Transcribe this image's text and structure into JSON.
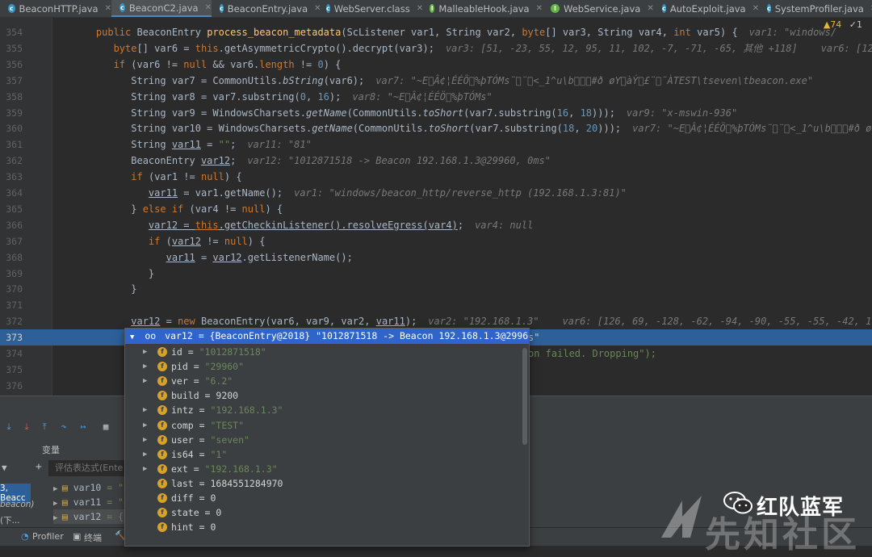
{
  "tabs": [
    {
      "label": "BeaconHTTP.java",
      "icon": "class-icon",
      "color": "#3592c4",
      "active": false
    },
    {
      "label": "BeaconC2.java",
      "icon": "class-icon",
      "color": "#3592c4",
      "active": true
    },
    {
      "label": "BeaconEntry.java",
      "icon": "class-icon",
      "color": "#3592c4",
      "active": false
    },
    {
      "label": "WebServer.class",
      "icon": "class-icon",
      "color": "#3592c4",
      "active": false
    },
    {
      "label": "MalleableHook.java",
      "icon": "interface-icon",
      "color": "#62b543",
      "active": false
    },
    {
      "label": "WebService.java",
      "icon": "interface-icon",
      "color": "#62b543",
      "active": false
    },
    {
      "label": "AutoExploit.java",
      "icon": "class-icon",
      "color": "#3592c4",
      "active": false
    },
    {
      "label": "SystemProfiler.java",
      "icon": "class-icon",
      "color": "#3592c4",
      "active": false
    }
  ],
  "inspection": {
    "warnings": "▲74",
    "weak": "✓1"
  },
  "lines": [
    {
      "n": "354",
      "segs": [
        [
          "    ",
          ""
        ],
        [
          "public ",
          "kw"
        ],
        [
          "BeaconEntry ",
          ""
        ],
        [
          "process_beacon_metadata",
          "fn"
        ],
        [
          "(ScListener var1, String var2, ",
          ""
        ],
        [
          "byte",
          "kw"
        ],
        [
          "[] var3, String var4, ",
          ""
        ],
        [
          "int ",
          "kw"
        ],
        [
          "var5) {",
          ""
        ]
      ],
      "hint": "var1: \"windows/"
    },
    {
      "n": "355",
      "segs": [
        [
          "       ",
          ""
        ],
        [
          "byte",
          "kw"
        ],
        [
          "[] var6 = ",
          ""
        ],
        [
          "this",
          "kw"
        ],
        [
          ".getAsymmetricCrypto().decrypt(var3);",
          ""
        ]
      ],
      "hint": "var3: [51, -23, 55, 12, 95, 11, 102, -7, -71, -65, 其他 +118]    var6: [126, 6"
    },
    {
      "n": "356",
      "segs": [
        [
          "       ",
          ""
        ],
        [
          "if ",
          "kw"
        ],
        [
          "(var6 != ",
          ""
        ],
        [
          "null ",
          "kw"
        ],
        [
          "&& var6.",
          ""
        ],
        [
          "length ",
          "kw"
        ],
        [
          "!= ",
          ""
        ],
        [
          "0",
          "num"
        ],
        [
          ") {",
          ""
        ]
      ],
      "hint": ""
    },
    {
      "n": "357",
      "segs": [
        [
          "          String var7 = CommonUtils.",
          ""
        ],
        [
          "bString",
          "it"
        ],
        [
          "(var6);",
          ""
        ]
      ],
      "hint": "var7: \"~E\u0000Â¢¦ÉÉÖ\u0000%þTÓMs¨\u0000¨\u0000<_1^u\\b\u0000\u0000\u0000#ð øY\u0000àÝ\u0000£¨\u0000¨ÀTEST\\tseven\\tbeacon.exe\""
    },
    {
      "n": "358",
      "segs": [
        [
          "          String var8 = var7.substring(",
          ""
        ],
        [
          "0",
          "num"
        ],
        [
          ", ",
          ""
        ],
        [
          "16",
          "num"
        ],
        [
          ");",
          ""
        ]
      ],
      "hint": "var8: \"~E\u0000Â¢¦ÉÉÖ\u0000%þTÓMs\""
    },
    {
      "n": "359",
      "segs": [
        [
          "          String var9 = WindowsCharsets.",
          ""
        ],
        [
          "getName",
          "it"
        ],
        [
          "(CommonUtils.",
          ""
        ],
        [
          "toShort",
          "it"
        ],
        [
          "(var7.substring(",
          ""
        ],
        [
          "16",
          "num"
        ],
        [
          ", ",
          ""
        ],
        [
          "18",
          "num"
        ],
        [
          ")));",
          ""
        ]
      ],
      "hint": "var9: \"x-mswin-936\""
    },
    {
      "n": "360",
      "segs": [
        [
          "          String var10 = WindowsCharsets.",
          ""
        ],
        [
          "getName",
          "it"
        ],
        [
          "(CommonUtils.",
          ""
        ],
        [
          "toShort",
          "it"
        ],
        [
          "(var7.substring(",
          ""
        ],
        [
          "18",
          "num"
        ],
        [
          ", ",
          ""
        ],
        [
          "20",
          "num"
        ],
        [
          ")));",
          ""
        ]
      ],
      "hint": "var7: \"~E\u0000Â¢¦ÉÉÖ\u0000%þTÓMs¨\u0000¨\u0000<_1^u\\b\u0000\u0000\u0000#ð øY\u0000àÝ"
    },
    {
      "n": "361",
      "segs": [
        [
          "          String ",
          ""
        ],
        [
          "var11",
          "ul"
        ],
        [
          " = ",
          ""
        ],
        [
          "\"\"",
          "str"
        ],
        [
          ";",
          ""
        ]
      ],
      "hint": "var11: \"81\""
    },
    {
      "n": "362",
      "segs": [
        [
          "          BeaconEntry ",
          ""
        ],
        [
          "var12",
          "ul"
        ],
        [
          ";",
          ""
        ]
      ],
      "hint": "var12: \"1012871518 -> Beacon 192.168.1.3@29960, 0ms\""
    },
    {
      "n": "363",
      "segs": [
        [
          "          ",
          ""
        ],
        [
          "if ",
          "kw"
        ],
        [
          "(var1 != ",
          ""
        ],
        [
          "null",
          "kw"
        ],
        [
          ") {",
          ""
        ]
      ],
      "hint": ""
    },
    {
      "n": "364",
      "segs": [
        [
          "             ",
          ""
        ],
        [
          "var11",
          "ul"
        ],
        [
          " = var1.getName();",
          ""
        ]
      ],
      "hint": "var1: \"windows/beacon_http/reverse_http (192.168.1.3:81)\""
    },
    {
      "n": "365",
      "segs": [
        [
          "          } ",
          ""
        ],
        [
          "else if ",
          "kw"
        ],
        [
          "(var4 != ",
          ""
        ],
        [
          "null",
          "kw"
        ],
        [
          ") {",
          ""
        ]
      ],
      "hint": ""
    },
    {
      "n": "366",
      "segs": [
        [
          "             ",
          ""
        ],
        [
          "var12 = ",
          "ul"
        ],
        [
          "this",
          "kw ul"
        ],
        [
          ".getCheckinListener().resolveEgress(var4)",
          "ul"
        ],
        [
          ";",
          ""
        ]
      ],
      "hint": "var4: null"
    },
    {
      "n": "367",
      "segs": [
        [
          "             ",
          ""
        ],
        [
          "if ",
          "kw"
        ],
        [
          "(",
          ""
        ],
        [
          "var12",
          "ul"
        ],
        [
          " != ",
          ""
        ],
        [
          "null",
          "kw"
        ],
        [
          ") {",
          ""
        ]
      ],
      "hint": ""
    },
    {
      "n": "368",
      "segs": [
        [
          "                ",
          ""
        ],
        [
          "var11",
          "ul"
        ],
        [
          " = ",
          ""
        ],
        [
          "var12",
          "ul"
        ],
        [
          ".getListenerName();",
          ""
        ]
      ],
      "hint": ""
    },
    {
      "n": "369",
      "segs": [
        [
          "             }",
          ""
        ]
      ],
      "hint": ""
    },
    {
      "n": "370",
      "segs": [
        [
          "          }",
          ""
        ]
      ],
      "hint": ""
    },
    {
      "n": "371",
      "segs": [
        [
          "",
          ""
        ]
      ],
      "hint": ""
    },
    {
      "n": "372",
      "segs": [
        [
          "          ",
          ""
        ],
        [
          "var12",
          "ul"
        ],
        [
          " = ",
          ""
        ],
        [
          "new ",
          "kw"
        ],
        [
          "BeaconEntry(var6, var9, var2, ",
          ""
        ],
        [
          "var11",
          "ul"
        ],
        [
          ");",
          ""
        ]
      ],
      "hint": "var2: \"192.168.1.3\"    var6: [126, 69, -128, -62, -94, -90, -55, -55, -42, 16, 其"
    },
    {
      "n": "373",
      "segs": [
        [
          "          ",
          ""
        ],
        [
          "if",
          "kw"
        ]
      ],
      "hint": "",
      "highlight": true,
      "tail": "s\""
    },
    {
      "n": "374",
      "segs": [
        [
          "",
          ""
        ]
      ],
      "hint": "",
      "tail": "on failed. Dropping\");"
    },
    {
      "n": "375",
      "segs": [
        [
          "",
          ""
        ]
      ],
      "hint": ""
    },
    {
      "n": "376",
      "segs": [
        [
          "          } e",
          ""
        ]
      ],
      "hint": ""
    }
  ],
  "popup": {
    "header": "var12 = {BeaconEntry@2018} \"1012871518 -> Beacon 192.168.1.3@29960, 0ms\"",
    "fields": [
      {
        "name": "id",
        "value": "\"1012871518\"",
        "kind": "s",
        "expand": true
      },
      {
        "name": "pid",
        "value": "\"29960\"",
        "kind": "s",
        "expand": true
      },
      {
        "name": "ver",
        "value": "\"6.2\"",
        "kind": "s",
        "expand": true
      },
      {
        "name": "build",
        "value": "9200",
        "kind": "n",
        "expand": false
      },
      {
        "name": "intz",
        "value": "\"192.168.1.3\"",
        "kind": "s",
        "expand": true
      },
      {
        "name": "comp",
        "value": "\"TEST\"",
        "kind": "s",
        "expand": true
      },
      {
        "name": "user",
        "value": "\"seven\"",
        "kind": "s",
        "expand": true
      },
      {
        "name": "is64",
        "value": "\"1\"",
        "kind": "s",
        "expand": true
      },
      {
        "name": "ext",
        "value": "\"192.168.1.3\"",
        "kind": "s",
        "expand": true
      },
      {
        "name": "last",
        "value": "1684551284970",
        "kind": "n",
        "expand": false
      },
      {
        "name": "diff",
        "value": "0",
        "kind": "n",
        "expand": false
      },
      {
        "name": "state",
        "value": "0",
        "kind": "n",
        "expand": false
      },
      {
        "name": "hint",
        "value": "0",
        "kind": "n",
        "expand": false
      }
    ]
  },
  "debug": {
    "variables_title": "变量",
    "eval_placeholder": "评估表达式(Ente",
    "left_frames": [
      "3, Beacc",
      "beacon)",
      "(下..."
    ],
    "var_rows": [
      {
        "name": "var10",
        "value": "= \"x"
      },
      {
        "name": "var11",
        "value": "= \"8"
      },
      {
        "name": "var12",
        "value": "= {B"
      }
    ]
  },
  "statusbar": {
    "profiler": "Profiler",
    "terminal": "终端"
  },
  "watermark": {
    "brand": "红队蓝军",
    "site": "先知社区"
  }
}
